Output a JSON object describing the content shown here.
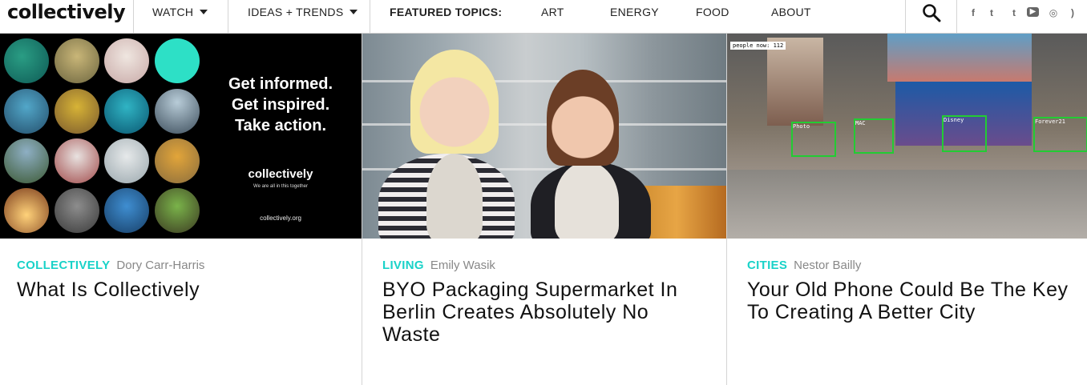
{
  "brand": {
    "logo_text": "collectively"
  },
  "nav": {
    "watch": "WATCH",
    "ideas": "IDEAS + TRENDS",
    "featured_label": "FEATURED TOPICS:",
    "topics": [
      "ART",
      "ENERGY",
      "FOOD",
      "ABOUT"
    ]
  },
  "social": {
    "facebook": "f",
    "twitter": "t",
    "tumblr": "t",
    "youtube": "▶",
    "instagram": "◎",
    "rss": ")"
  },
  "cards": [
    {
      "category": "COLLECTIVELY",
      "author": "Dory Carr-Harris",
      "title": "What Is Collectively",
      "image": {
        "tagline": [
          "Get informed.",
          "Get inspired.",
          "Take action."
        ],
        "logo": "collectively",
        "sub": "We are all in this together",
        "url": "collectively.org"
      }
    },
    {
      "category": "LIVING",
      "author": "Emily Wasik",
      "title": "BYO Packaging Supermarket In Berlin Creates Absolutely No Waste"
    },
    {
      "category": "CITIES",
      "author": "Nestor Bailly",
      "title": "Your Old Phone Could Be The Key To Creating A Better City",
      "image": {
        "hud": "people now: 112",
        "labels": [
          "Photo",
          "MAC",
          "Disney",
          "Forever21"
        ]
      }
    }
  ],
  "colors": {
    "accent": "#19d2c8",
    "detect": "#22cc33"
  }
}
